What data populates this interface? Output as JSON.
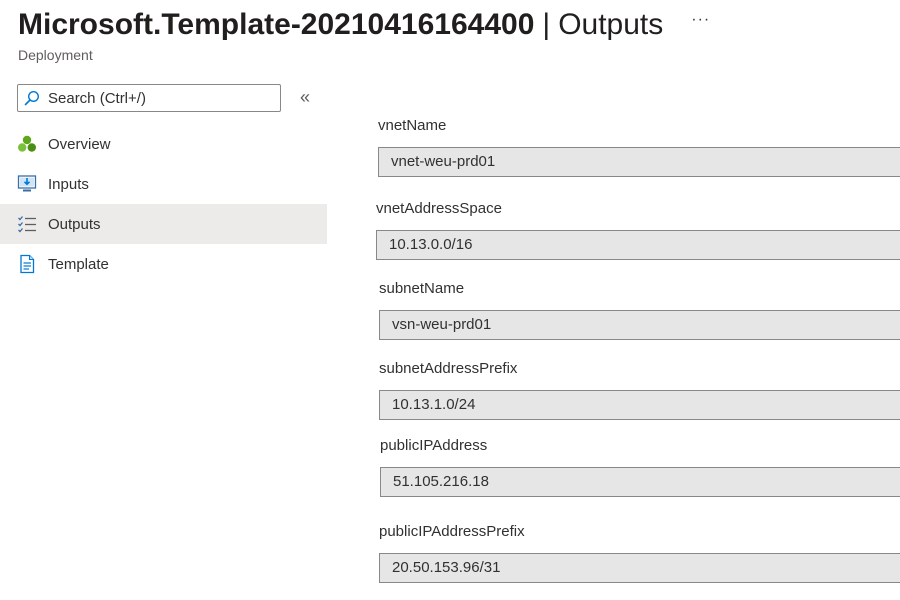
{
  "header": {
    "resource_name": "Microsoft.Template-20210416164400",
    "separator": "|",
    "section_name": "Outputs",
    "more_label": "···",
    "subtitle": "Deployment"
  },
  "sidebar": {
    "search": {
      "placeholder": "Search (Ctrl+/)",
      "icon": "search-icon"
    },
    "collapse_label": "«",
    "items": [
      {
        "label": "Overview",
        "icon": "overview-icon",
        "selected": false
      },
      {
        "label": "Inputs",
        "icon": "inputs-icon",
        "selected": false
      },
      {
        "label": "Outputs",
        "icon": "outputs-icon",
        "selected": true
      },
      {
        "label": "Template",
        "icon": "template-icon",
        "selected": false
      }
    ]
  },
  "outputs": [
    {
      "name": "vnetName",
      "value": "vnet-weu-prd01"
    },
    {
      "name": "vnetAddressSpace",
      "value": "10.13.0.0/16"
    },
    {
      "name": "subnetName",
      "value": "vsn-weu-prd01"
    },
    {
      "name": "subnetAddressPrefix",
      "value": "10.13.1.0/24"
    },
    {
      "name": "publicIPAddress",
      "value": "51.105.216.18"
    },
    {
      "name": "publicIPAddressPrefix",
      "value": "20.50.153.96/31"
    }
  ],
  "colors": {
    "selected_bg": "#edebe9",
    "field_bg": "#e6e6e6",
    "accent_blue": "#0078d4",
    "overview_green": "#5ea71a"
  }
}
